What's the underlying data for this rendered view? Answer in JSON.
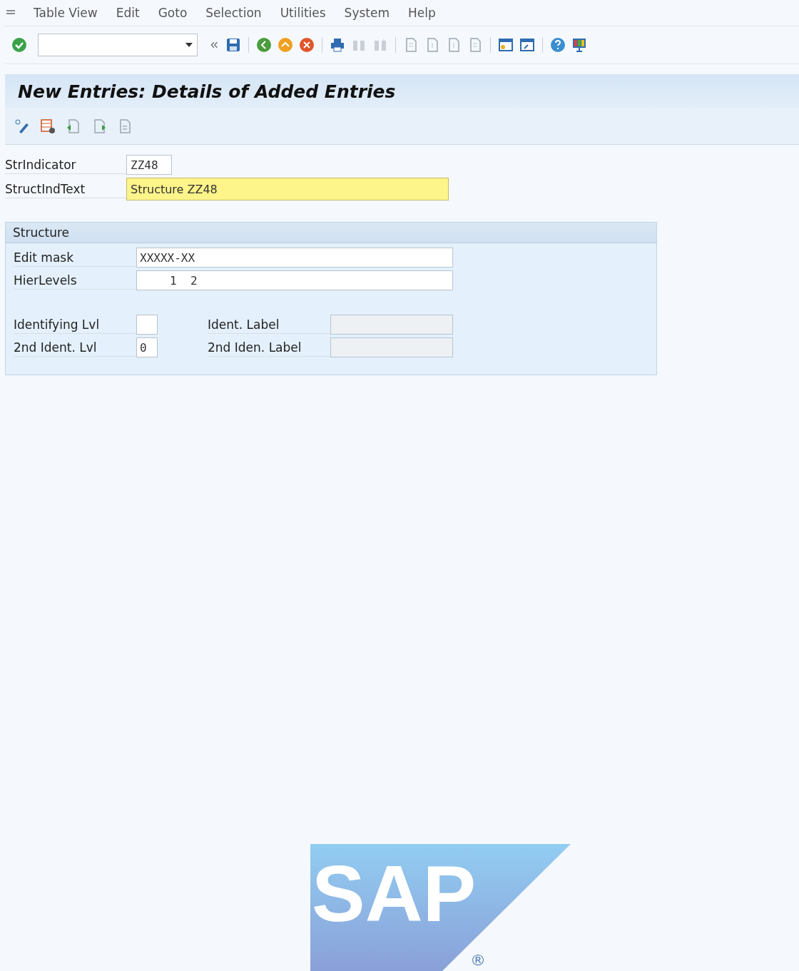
{
  "menu": [
    {
      "label": "Table View"
    },
    {
      "label": "Edit"
    },
    {
      "label": "Goto"
    },
    {
      "label": "Selection"
    },
    {
      "label": "Utilities"
    },
    {
      "label": "System"
    },
    {
      "label": "Help"
    }
  ],
  "title": "New Entries: Details of Added Entries",
  "fields": [
    {
      "label": "StrIndicator",
      "value": "ZZ48",
      "required": false
    },
    {
      "label": "StructIndText",
      "value": "Structure ZZ48",
      "required": true
    }
  ],
  "group": {
    "title": "Structure",
    "rows": [
      {
        "label": "Edit mask",
        "value": "XXXXX-XX"
      },
      {
        "label": "HierLevels",
        "value": "1  2"
      }
    ],
    "pairs": [
      {
        "level": {
          "label": "Identifying Lvl"
        },
        "ident": {
          "label": "Ident. Label",
          "disabled": true
        }
      },
      {
        "level": {
          "label": "2nd Ident. Lvl",
          "value": "0"
        },
        "ident": {
          "label": "2nd Iden. Label",
          "disabled": true
        }
      }
    ]
  },
  "logo": {
    "text": "SAP",
    "mark": "®"
  }
}
